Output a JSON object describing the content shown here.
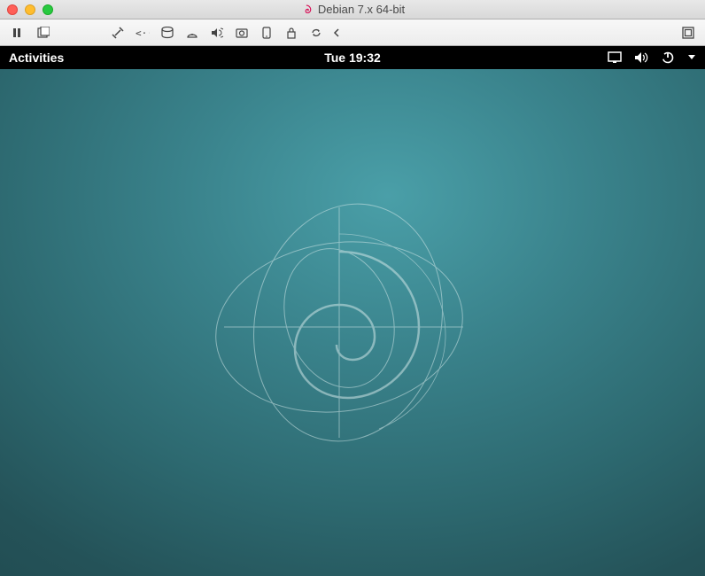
{
  "window": {
    "title": "Debian 7.x 64-bit"
  },
  "gnome": {
    "activities_label": "Activities",
    "clock": "Tue 19:32"
  },
  "icons": {
    "close": "close-icon",
    "minimize": "minimize-icon",
    "maximize": "maximize-icon",
    "pause": "pause-icon",
    "snapshot": "snapshot-icon",
    "settings": "settings-icon",
    "network": "network-icon",
    "harddisk": "harddisk-icon",
    "optical": "optical-icon",
    "sound": "sound-icon",
    "camera": "camera-icon",
    "mobile": "mobile-icon",
    "lock": "lock-icon",
    "sync": "sync-icon",
    "chevron_left": "chevron-left-icon",
    "fullscreen": "fullscreen-icon",
    "display": "display-icon",
    "volume": "volume-icon",
    "power": "power-icon",
    "dropdown": "dropdown-icon"
  }
}
